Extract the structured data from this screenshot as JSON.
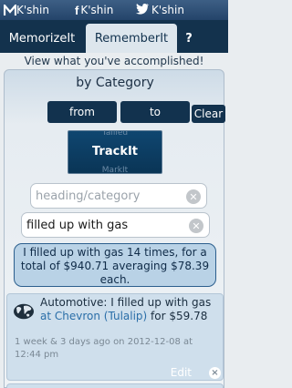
{
  "social": {
    "items": [
      {
        "icon": "kshin-logo-icon",
        "label": "K'shin"
      },
      {
        "icon": "facebook-icon",
        "label": "K'shin"
      },
      {
        "icon": "twitter-icon",
        "label": "K'shin"
      }
    ]
  },
  "tabs": [
    {
      "label": "MemorizeIt",
      "active": false
    },
    {
      "label": "RememberIt",
      "active": true
    },
    {
      "label": "?",
      "active": false
    }
  ],
  "subhead": "View what you've accomplished!",
  "category_title": "by Category",
  "buttons": {
    "from": "from",
    "to": "to",
    "clear": "Clear"
  },
  "trackit": {
    "ghost_top": "Tallied",
    "label": "TrackIt",
    "ghost_bottom": "MarkIt"
  },
  "fields": {
    "heading_placeholder": "heading/category",
    "search_value": "filled up with gas"
  },
  "summary": "I filled up with gas 14 times, for a total of $940.71 averaging $78.39 each.",
  "entry": {
    "category": "Automotive:",
    "text_before_link": " I filled up with gas ",
    "link": "at Chevron (Tulalip)",
    "text_after_link": " for $59.78",
    "meta": "1 week & 3 days ago on 2012-12-08 at 12:44 pm",
    "edit": "Edit",
    "delete": "×"
  },
  "colors": {
    "navy": "#12324e",
    "accent_link": "#2a6ea8",
    "summary_bg": "#b9d2e6"
  }
}
